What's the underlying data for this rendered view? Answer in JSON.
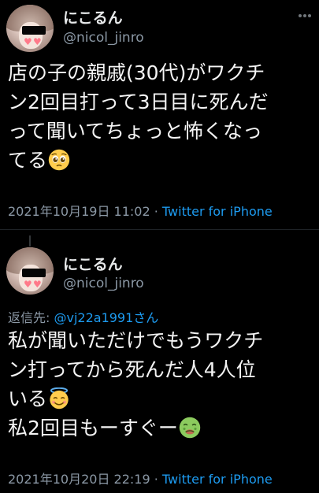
{
  "tweets": [
    {
      "display_name": "にこるん",
      "handle": "@nicol_jinro",
      "reply_label": "",
      "reply_mention": "",
      "reply_suffix": "",
      "lines": [
        "店の子の親戚(30代)がワクチ",
        "ン2回目打って3日目に死んだ",
        "って聞いてちょっと怖くなっ",
        "てる"
      ],
      "emoji": "pleading-face",
      "timestamp": "2021年10月19日 11:02",
      "separator": "·",
      "source": "Twitter for iPhone"
    },
    {
      "display_name": "にこるん",
      "handle": "@nicol_jinro",
      "reply_label": "返信先: ",
      "reply_mention": "@vj22a1991",
      "reply_suffix": "さん",
      "lines": [
        "私が聞いただけでもうワクチ",
        "ン打ってから死んだ人4人位",
        "いる",
        "私2回目もーすぐー"
      ],
      "emoji_line3": "smiling-face-with-halo",
      "emoji_line4": "nauseated-face",
      "timestamp": "2021年10月20日 22:19",
      "separator": "·",
      "source": "Twitter for iPhone"
    }
  ],
  "colors": {
    "background": "#000000",
    "text": "#e7e9ea",
    "secondary": "#8b98a5",
    "link": "#1d9bf0"
  }
}
